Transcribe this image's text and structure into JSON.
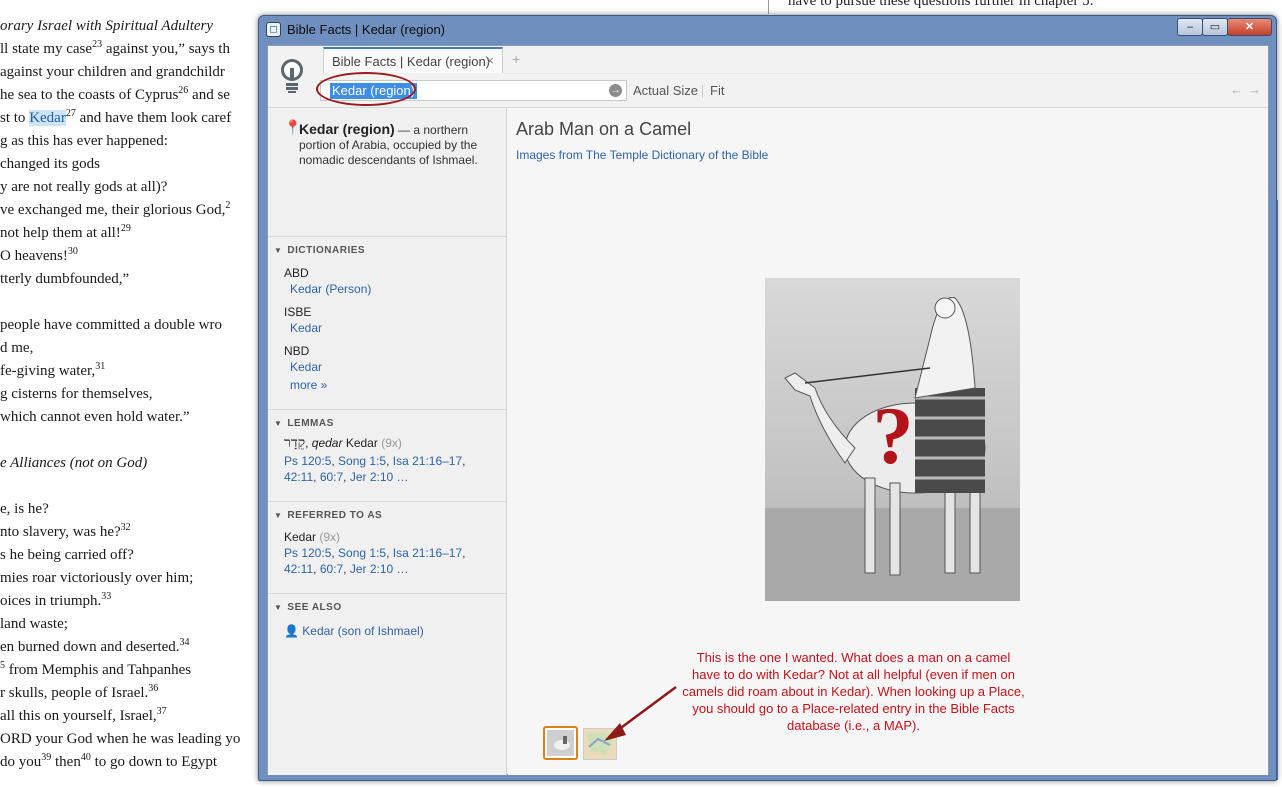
{
  "background_doc": {
    "lines": [
      {
        "text": "orary Israel with Spiritual Adultery",
        "italic": true
      },
      {
        "text": "ll state my case",
        "sup": "23",
        "after": " against you,” says th"
      },
      {
        "text": "against your children and grandchildr"
      },
      {
        "text": "he sea to the coasts of Cyprus",
        "sup": "26",
        "after": " and se"
      },
      {
        "text": "st to ",
        "highlight": "Kedar",
        "sup": "27",
        "after": " and have them look caref"
      },
      {
        "text": "g as this has ever happened:"
      },
      {
        "text": "changed its gods"
      },
      {
        "text": "y are not really gods at all)?"
      },
      {
        "text": "ve exchanged me, their glorious God,",
        "sup": "2"
      },
      {
        "text": "not help them at all!",
        "sup": "29"
      },
      {
        "text": " O heavens!",
        "sup": "30"
      },
      {
        "text": "tterly dumbfounded,”"
      },
      {
        "text": ""
      },
      {
        "text": "people have committed a double wro"
      },
      {
        "text": "d me,"
      },
      {
        "text": "fe-giving water,",
        "sup": "31"
      },
      {
        "text": "g cisterns for themselves,"
      },
      {
        "text": "which cannot even hold water.”"
      },
      {
        "text": ""
      },
      {
        "text": "e Alliances (not on God)",
        "italic": true
      },
      {
        "text": ""
      },
      {
        "text": "e, is he?"
      },
      {
        "text": "nto slavery, was he?",
        "sup": "32"
      },
      {
        "text": "s he being carried off?"
      },
      {
        "text": "mies roar victoriously over him;"
      },
      {
        "text": "oices in triumph.",
        "sup": "33"
      },
      {
        "text": " land waste;"
      },
      {
        "text": "en burned down and deserted.",
        "sup": "34"
      },
      {
        "text": "",
        "sup": "5",
        "after": " from Memphis and Tahpanhes"
      },
      {
        "text": "r skulls, people of Israel.",
        "sup": "36"
      },
      {
        "text": " all this on yourself, Israel,",
        "sup": "37"
      },
      {
        "text": "ORD your God when he was leading yo"
      },
      {
        "text": "do you",
        "sup": "39",
        "after": " then",
        "sup2": "40",
        "after2": " to go down to Egypt"
      }
    ],
    "right_top_text": "have to pursue these questions further in chapter 5."
  },
  "window": {
    "title": "Bible Facts | Kedar (region)",
    "min_label": "–",
    "max_label": "▭",
    "close_label": "✕"
  },
  "tab": {
    "label": "Bible Facts | Kedar (region)",
    "close_label": "×",
    "add_label": "+"
  },
  "toolbar": {
    "search_value": "Kedar (region)",
    "go_label": "→",
    "actual_size_label": "Actual Size",
    "fit_label": "Fit",
    "back_label": "←",
    "forward_label": "→"
  },
  "summary": {
    "title": "Kedar (region)",
    "description": " — a northern portion of Arabia, occupied by the nomadic descendants of Ishmael."
  },
  "dictionaries": {
    "heading": "DICTIONARIES",
    "entries": [
      {
        "source": "ABD",
        "link": "Kedar (Person)"
      },
      {
        "source": "ISBE",
        "link": "Kedar"
      },
      {
        "source": "NBD",
        "link": "Kedar"
      }
    ],
    "more_label": "more »"
  },
  "lemmas": {
    "heading": "LEMMAS",
    "hebrew": "קֵדָר",
    "translit": "qedar",
    "gloss": "Kedar",
    "count": "(9x)",
    "refs": [
      "Ps 120:5",
      "Song 1:5",
      "Isa 21:16–17",
      "42:11",
      "60:7",
      "Jer 2:10 …"
    ]
  },
  "referred_to_as": {
    "heading": "REFERRED TO AS",
    "name": "Kedar",
    "count": "(9x)",
    "refs": [
      "Ps 120:5",
      "Song 1:5",
      "Isa 21:16–17",
      "42:11",
      "60:7",
      "Jer 2:10 …"
    ]
  },
  "see_also": {
    "heading": "SEE ALSO",
    "link": "Kedar (son of Ishmael)"
  },
  "content": {
    "image_title": "Arab Man on a Camel",
    "image_source": "Images from The Temple Dictionary of the Bible",
    "question_mark": "?",
    "annotation": "This is the one I wanted. What does a man on a camel have to do with Kedar? Not at all helpful (even if men on camels did roam about in Kedar). When looking up a Place, you should go to a Place-related entry in the Bible Facts database (i.e., a MAP)."
  },
  "colors": {
    "window_frame": "#6f8fbf",
    "link": "#2e63a8",
    "selection": "#3e8ee6",
    "annotation": "#c4121b",
    "thumb_active": "#d9811a"
  }
}
